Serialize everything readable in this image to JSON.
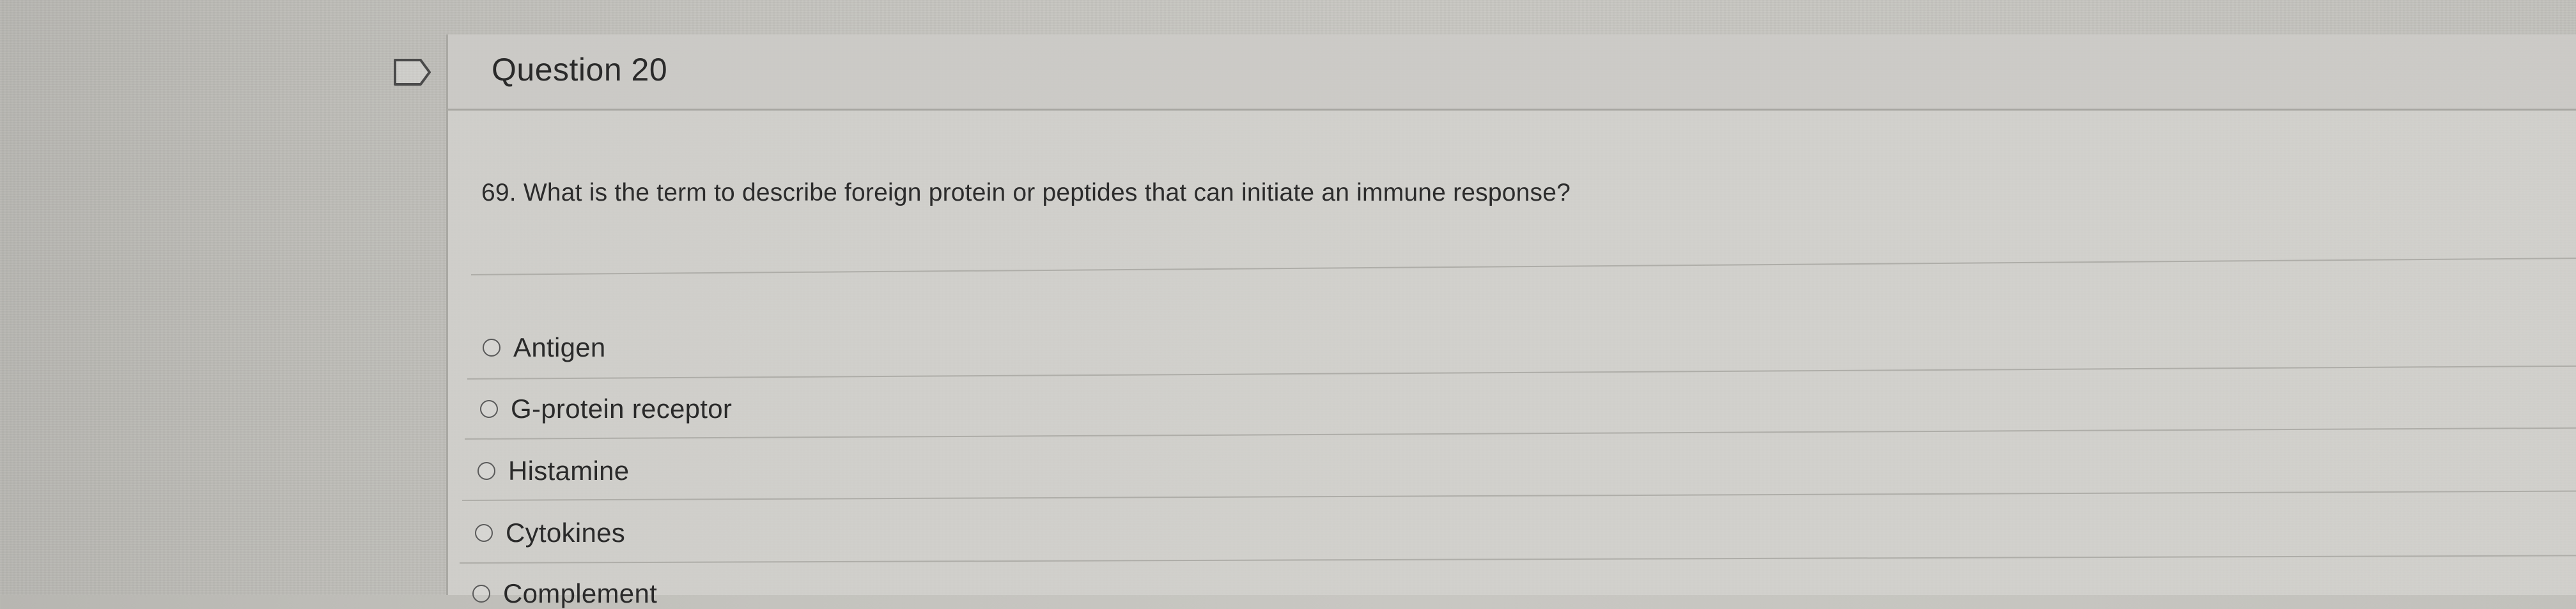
{
  "question": {
    "title": "Question 20",
    "text": "69. What is the term to describe foreign protein or peptides that can initiate an immune response?"
  },
  "answers": [
    {
      "label": "Antigen"
    },
    {
      "label": "G-protein receptor"
    },
    {
      "label": "Histamine"
    },
    {
      "label": "Cytokines"
    },
    {
      "label": "Complement"
    }
  ],
  "icons": {
    "flag": "bookmark-flag-icon",
    "radio": "radio-button-icon"
  },
  "colors": {
    "text": "#2a2a2a",
    "flag_outline": "#4a4a4a"
  }
}
